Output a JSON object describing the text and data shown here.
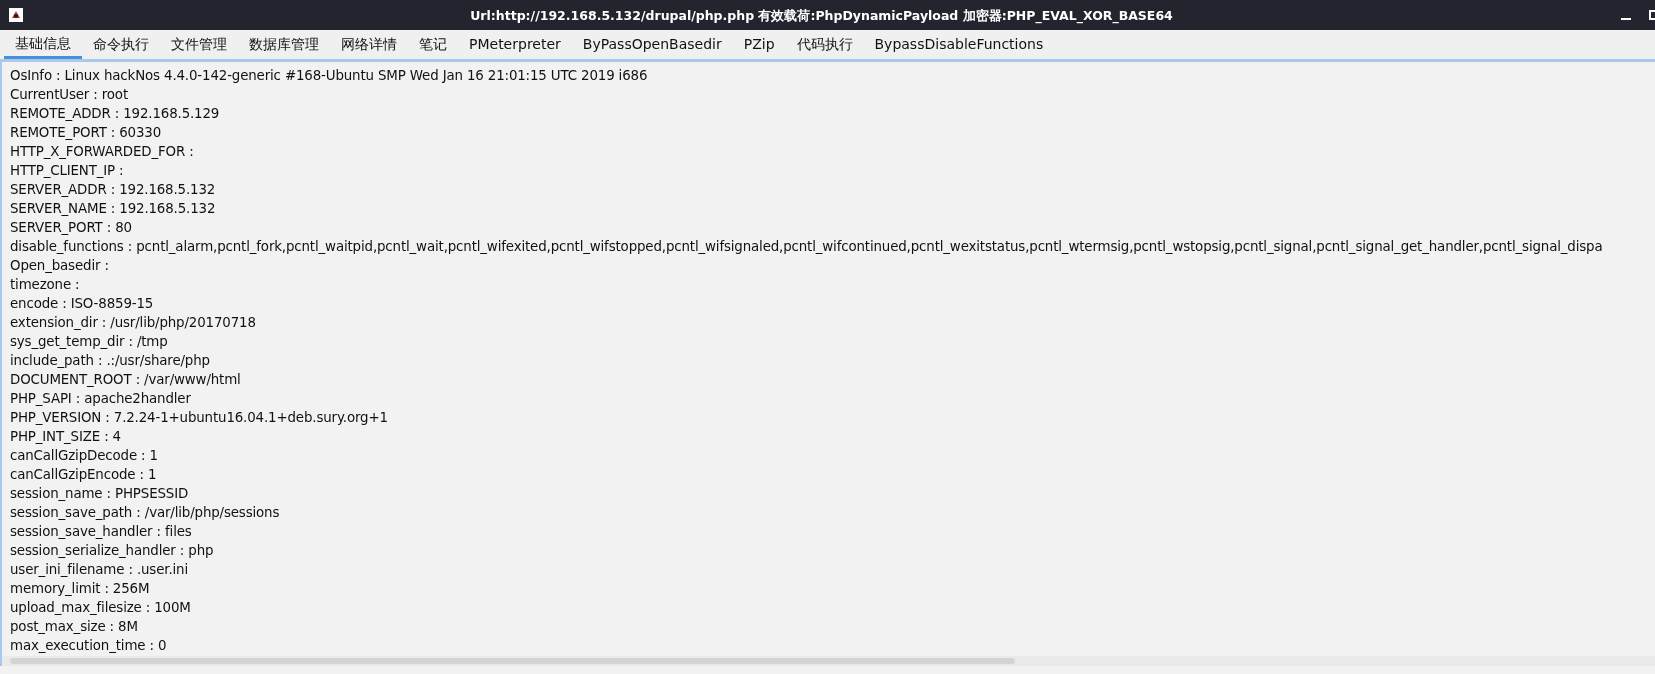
{
  "window": {
    "title": "Url:http://192.168.5.132/drupal/php.php 有效载荷:PhpDynamicPayload 加密器:PHP_EVAL_XOR_BASE64"
  },
  "tabs": [
    {
      "label": "基础信息",
      "selected": true
    },
    {
      "label": "命令执行",
      "selected": false
    },
    {
      "label": "文件管理",
      "selected": false
    },
    {
      "label": "数据库管理",
      "selected": false
    },
    {
      "label": "网络详情",
      "selected": false
    },
    {
      "label": "笔记",
      "selected": false
    },
    {
      "label": "PMeterpreter",
      "selected": false
    },
    {
      "label": "ByPassOpenBasedir",
      "selected": false
    },
    {
      "label": "PZip",
      "selected": false
    },
    {
      "label": "代码执行",
      "selected": false
    },
    {
      "label": "BypassDisableFunctions",
      "selected": false
    }
  ],
  "info_lines": [
    "OsInfo : Linux hackNos 4.4.0-142-generic #168-Ubuntu SMP Wed Jan 16 21:01:15 UTC 2019 i686",
    "CurrentUser : root",
    "REMOTE_ADDR : 192.168.5.129",
    "REMOTE_PORT : 60330",
    "HTTP_X_FORWARDED_FOR :",
    "HTTP_CLIENT_IP :",
    "SERVER_ADDR : 192.168.5.132",
    "SERVER_NAME : 192.168.5.132",
    "SERVER_PORT : 80",
    "disable_functions : pcntl_alarm,pcntl_fork,pcntl_waitpid,pcntl_wait,pcntl_wifexited,pcntl_wifstopped,pcntl_wifsignaled,pcntl_wifcontinued,pcntl_wexitstatus,pcntl_wtermsig,pcntl_wstopsig,pcntl_signal,pcntl_signal_get_handler,pcntl_signal_dispa",
    "Open_basedir :",
    "timezone :",
    "encode : ISO-8859-15",
    "extension_dir : /usr/lib/php/20170718",
    "sys_get_temp_dir : /tmp",
    "include_path : .:/usr/share/php",
    "DOCUMENT_ROOT : /var/www/html",
    "PHP_SAPI : apache2handler",
    "PHP_VERSION : 7.2.24-1+ubuntu16.04.1+deb.sury.org+1",
    "PHP_INT_SIZE : 4",
    "canCallGzipDecode : 1",
    "canCallGzipEncode : 1",
    "session_name : PHPSESSID",
    "session_save_path : /var/lib/php/sessions",
    "session_save_handler : files",
    "session_serialize_handler : php",
    "user_ini_filename : .user.ini",
    "memory_limit : 256M",
    "upload_max_filesize : 100M",
    "post_max_size : 8M",
    "max_execution_time : 0"
  ]
}
